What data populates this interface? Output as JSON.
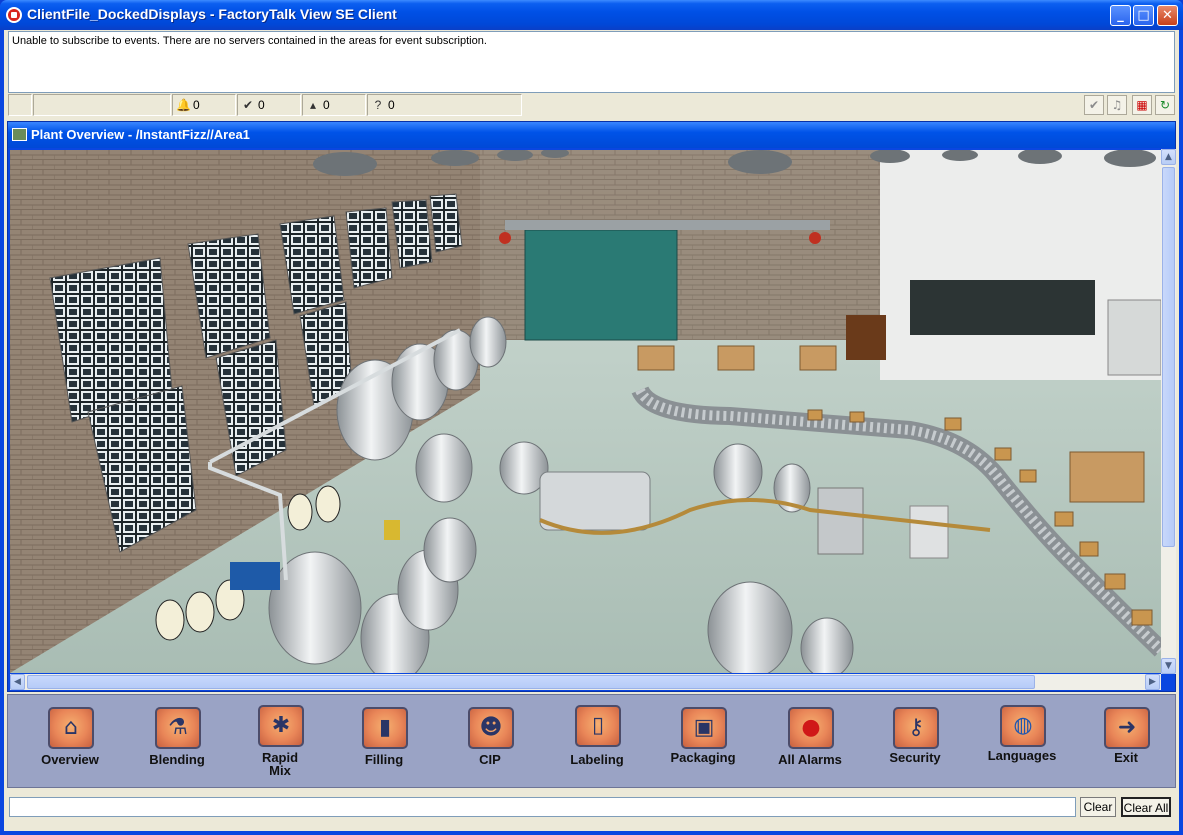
{
  "window": {
    "title": "ClientFile_DockedDisplays - FactoryTalk View SE Client",
    "minimize_label": "_",
    "maximize_label": "□",
    "close_label": "✕"
  },
  "events": {
    "message": "Unable to subscribe to events.  There are no servers contained in the areas for event subscription."
  },
  "alarm_counts": [
    {
      "icon": "bell-icon",
      "value": "0"
    },
    {
      "icon": "acknowledged-icon",
      "value": "0"
    },
    {
      "icon": "shelved-icon",
      "value": "0"
    },
    {
      "icon": "unknown-icon",
      "value": "0"
    }
  ],
  "toolbar": {
    "ack_icon": "checkmark-icon",
    "silence_icon": "silence-icon",
    "summary_icon": "alarm-summary-icon",
    "refresh_icon": "refresh-icon"
  },
  "display": {
    "title": "Plant Overview - /InstantFizz//Area1"
  },
  "nav_buttons": [
    {
      "label": "Overview",
      "icon": "house-icon",
      "glyph": "⌂"
    },
    {
      "label": "Blending",
      "icon": "beaker-icon",
      "glyph": "⚗"
    },
    {
      "label": "Rapid\nMix",
      "icon": "mixer-icon",
      "glyph": "✱"
    },
    {
      "label": "Filling",
      "icon": "bottle-icon",
      "glyph": "▮"
    },
    {
      "label": "CIP",
      "icon": "worker-icon",
      "glyph": "☻"
    },
    {
      "label": "Labeling",
      "icon": "label-bottle-icon",
      "glyph": "▯"
    },
    {
      "label": "Packaging",
      "icon": "box-icon",
      "glyph": "▣"
    },
    {
      "label": "All Alarms",
      "icon": "alarm-light-icon",
      "glyph": "●"
    },
    {
      "label": "Security",
      "icon": "key-icon",
      "glyph": "⚷"
    },
    {
      "label": "Languages",
      "icon": "globe-icon",
      "glyph": "◍"
    },
    {
      "label": "Exit",
      "icon": "exit-runner-icon",
      "glyph": "➜"
    }
  ],
  "status": {
    "clear_label": "Clear",
    "clear_all_label": "Clear All"
  }
}
